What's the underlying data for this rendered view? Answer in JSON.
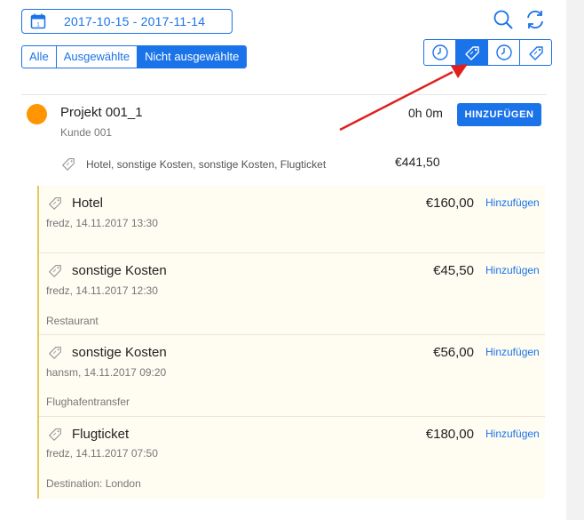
{
  "date_range": {
    "label": "2017-10-15 - 2017-11-14",
    "icon": "calendar-icon"
  },
  "top_icons": {
    "search": "search-icon",
    "refresh": "refresh-icon"
  },
  "filter": {
    "options": [
      "Alle",
      "Ausgewählte",
      "Nicht ausgewählte"
    ],
    "selected": "Nicht ausgewählte"
  },
  "view_toggle": {
    "icons": [
      "clock-icon",
      "tag-icon",
      "clock-icon",
      "tag-icon"
    ],
    "selected_index": 1
  },
  "project": {
    "name": "Projekt 001_1",
    "client": "Kunde 001",
    "time": "0h 0m",
    "add_label": "HINZUFÜGEN",
    "color": "#ff9500",
    "expense_summary": "Hotel, sonstige Kosten, sonstige Kosten, Flugticket",
    "expense_total": "€441,50"
  },
  "entries": [
    {
      "title": "Hotel",
      "meta": "fredz, 14.11.2017 13:30",
      "amount": "€160,00",
      "link": "Hinzufügen",
      "note": ""
    },
    {
      "title": "sonstige Kosten",
      "meta": "fredz, 14.11.2017 12:30",
      "amount": "€45,50",
      "link": "Hinzufügen",
      "note": "Restaurant"
    },
    {
      "title": "sonstige Kosten",
      "meta": "hansm, 14.11.2017 09:20",
      "amount": "€56,00",
      "link": "Hinzufügen",
      "note": "Flughafentransfer"
    },
    {
      "title": "Flugticket",
      "meta": "fredz, 14.11.2017 07:50",
      "amount": "€180,00",
      "link": "Hinzufügen",
      "note": "Destination: London"
    }
  ],
  "colors": {
    "accent": "#1a73e8",
    "project_dot": "#ff9500",
    "annotation_arrow": "#e02020"
  }
}
